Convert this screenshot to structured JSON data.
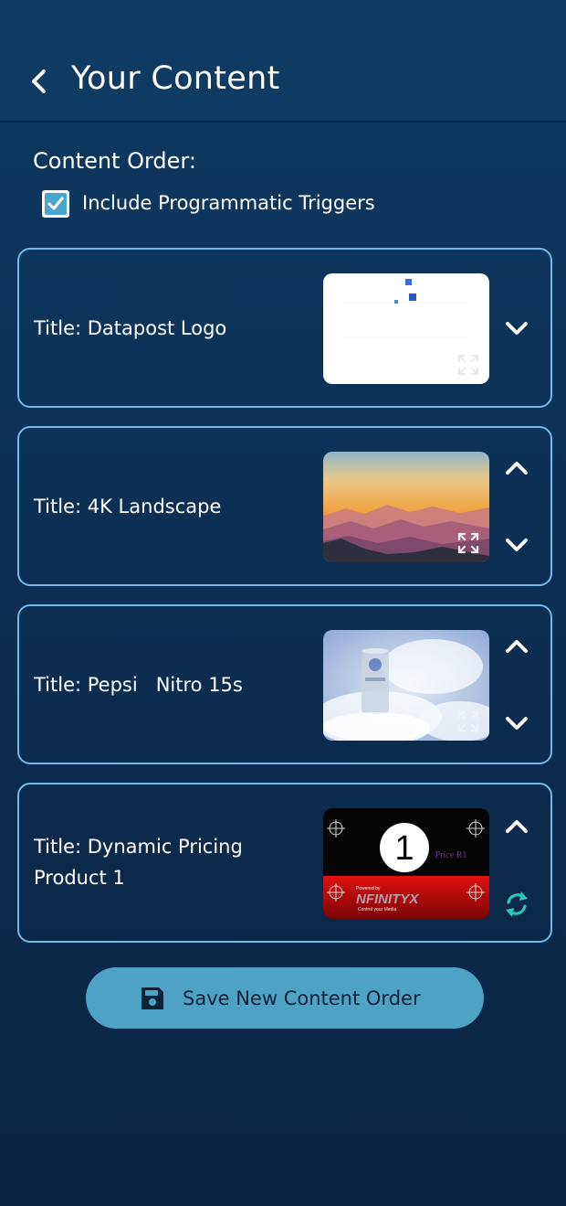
{
  "header": {
    "title": "Your Content",
    "back_icon": "chevron-left-icon"
  },
  "content_order": {
    "label": "Content Order:",
    "checkbox": {
      "label": "Include Programmatic Triggers",
      "checked": true
    }
  },
  "items": [
    {
      "title": "Title: Datapost Logo",
      "thumbnail": "white logo graphic with small blue squares",
      "controls": [
        "move-down"
      ]
    },
    {
      "title": "Title: 4K Landscape",
      "thumbnail": "sunset over misty mountains",
      "controls": [
        "move-up",
        "move-down"
      ]
    },
    {
      "title": "Title: Pepsi   Nitro 15s",
      "thumbnail": "Pepsi Nitro can in clouds",
      "controls": [
        "move-up",
        "move-down"
      ]
    },
    {
      "title_line1": "Title: Dynamic Pricing",
      "title_line2": "Product 1",
      "thumbnail": "dynamic pricing template",
      "thumb_number": "1",
      "thumb_price": "Price R1",
      "thumb_powered": "Powered by",
      "thumb_logo": "NFINITYX",
      "thumb_tagline": "Control your Media",
      "controls": [
        "move-up",
        "refresh"
      ]
    }
  ],
  "save_button": {
    "label": "Save New Content Order",
    "icon": "floppy-disk-icon"
  },
  "colors": {
    "background": "#0c2f53",
    "card_border": "#73b8e6",
    "accent": "#4ba6cf",
    "refresh_icon": "#2ec4b6",
    "button": "#4ea3c5"
  }
}
